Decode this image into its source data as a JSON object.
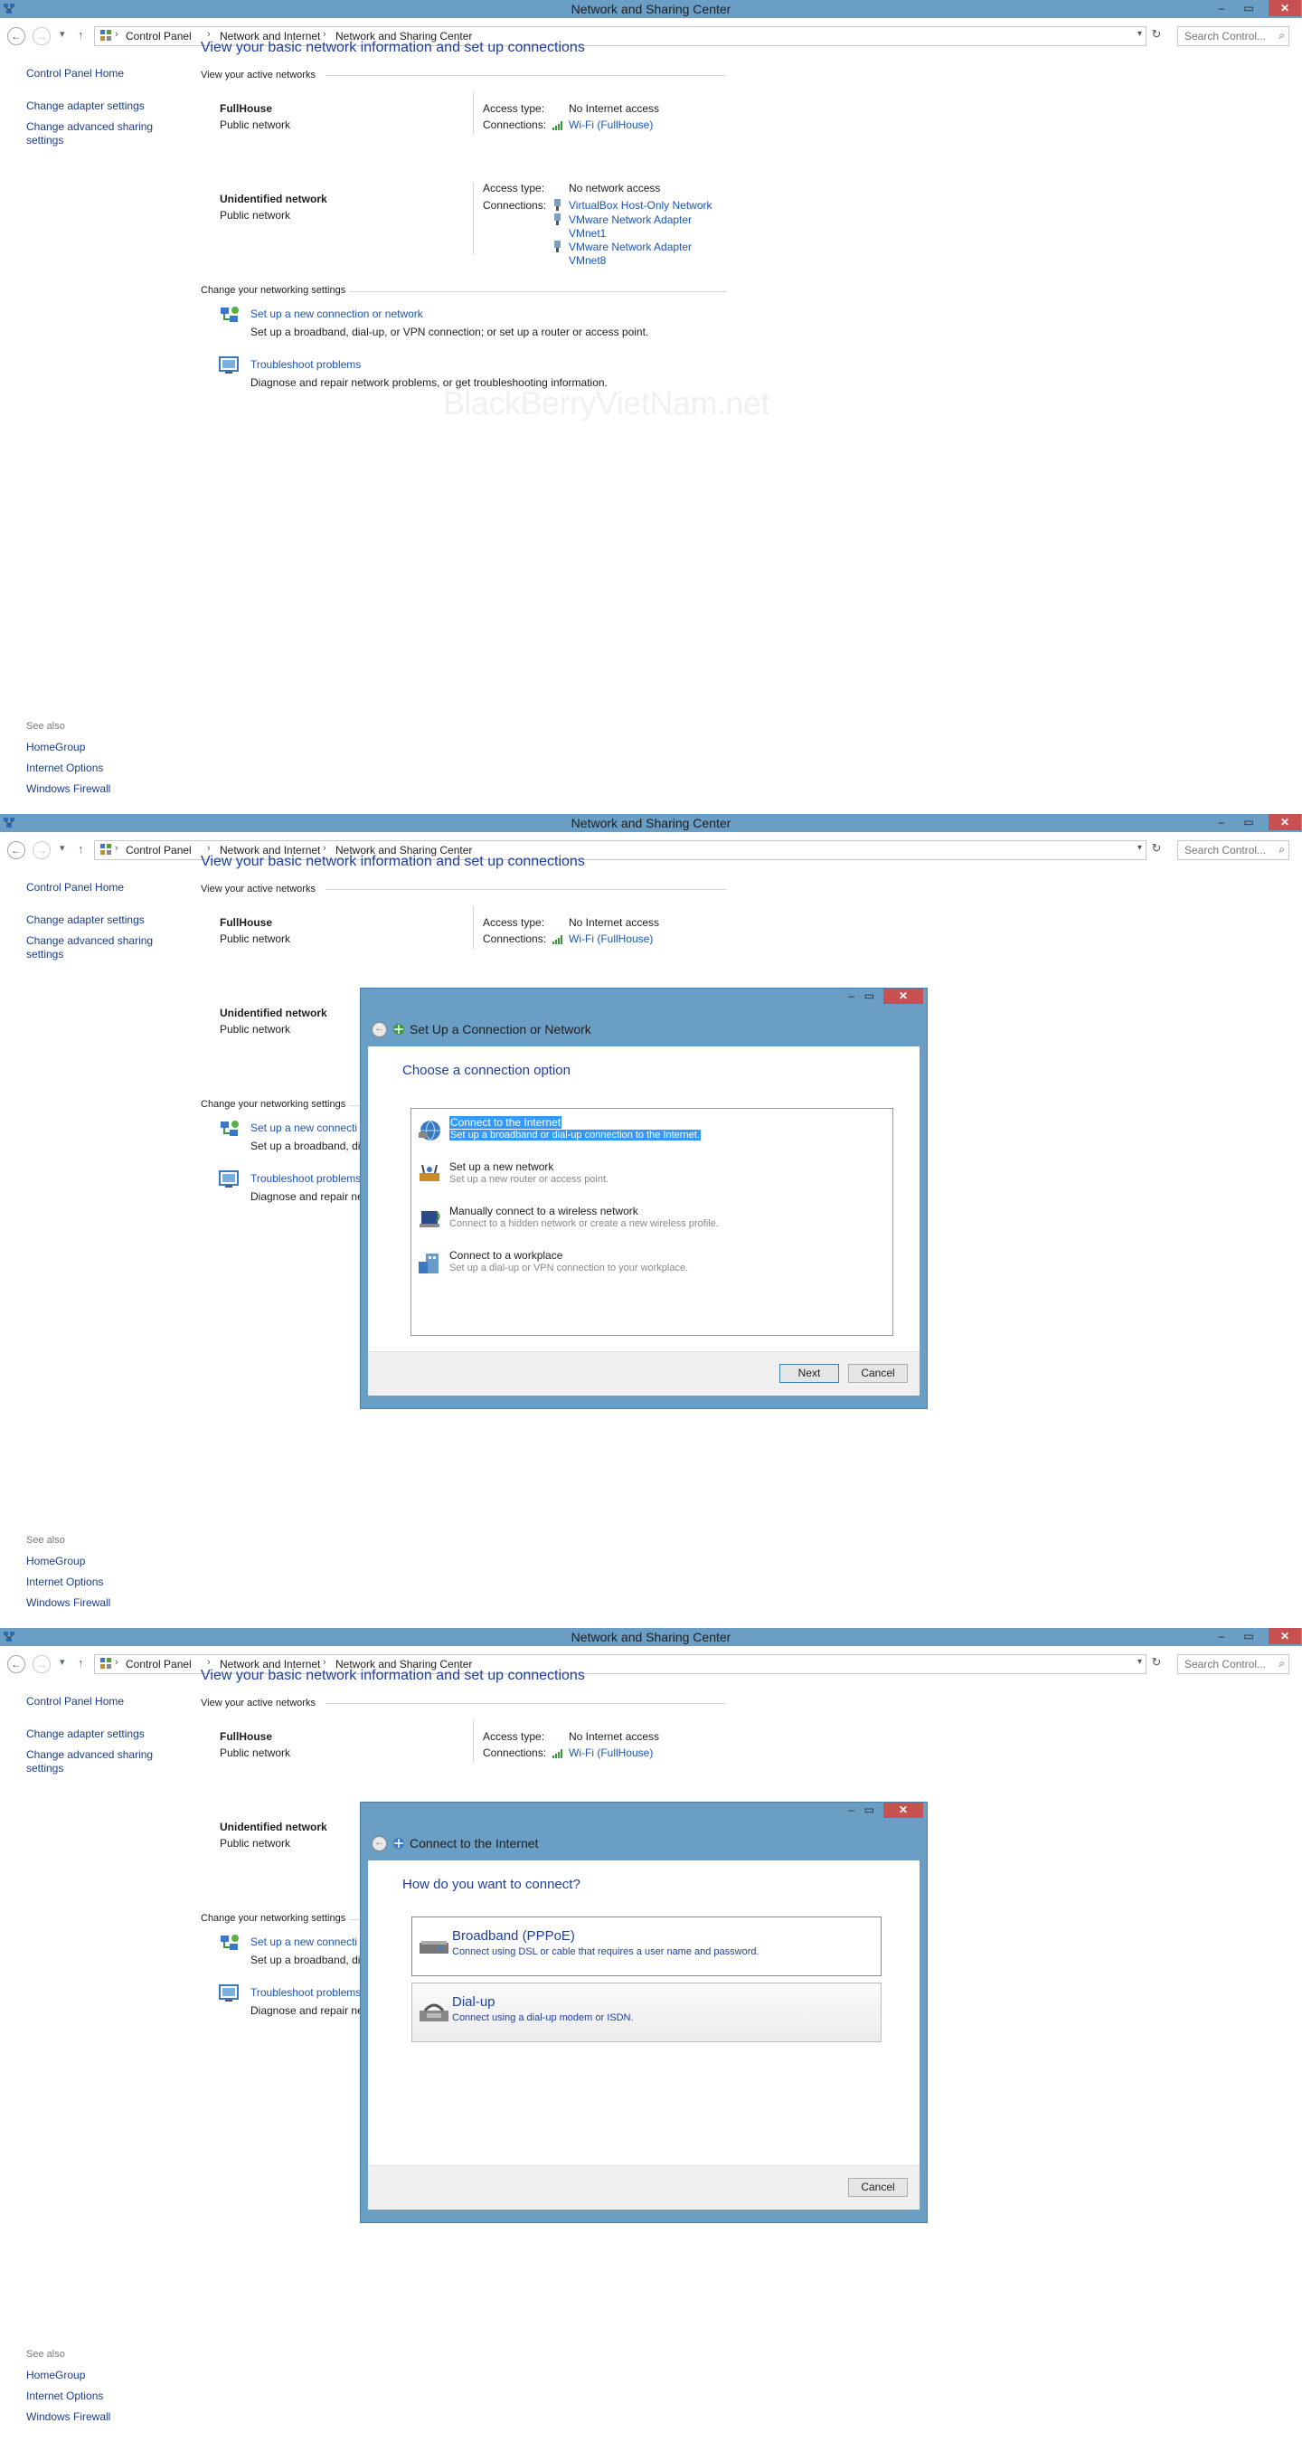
{
  "window": {
    "title": "Network and Sharing Center",
    "controls": {
      "minimize": "–",
      "maximize": "▭",
      "close": "✕"
    }
  },
  "address": {
    "crumbs": [
      "Control Panel",
      "Network and Internet",
      "Network and Sharing Center"
    ],
    "search_placeholder": "Search Control..."
  },
  "sidebar": {
    "home": "Control Panel Home",
    "items": [
      "Change adapter settings",
      "Change advanced sharing",
      "settings"
    ],
    "see_also_title": "See also",
    "see_also": [
      "HomeGroup",
      "Internet Options",
      "Windows Firewall"
    ]
  },
  "main": {
    "heading": "View your basic network information and set up connections",
    "active_networks_label": "View your active networks",
    "networks": [
      {
        "name": "FullHouse",
        "type": "Public network",
        "access_label": "Access type:",
        "access_value": "No Internet access",
        "connections_label": "Connections:",
        "connections": [
          "Wi-Fi (FullHouse)"
        ]
      },
      {
        "name": "Unidentified network",
        "type": "Public network",
        "access_label": "Access type:",
        "access_value": "No network access",
        "connections_label": "Connections:",
        "connections": [
          "VirtualBox Host-Only Network",
          "VMware Network Adapter",
          "VMnet1",
          "VMware Network Adapter",
          "VMnet8"
        ]
      }
    ],
    "change_settings_label": "Change your networking settings",
    "tasks": [
      {
        "title": "Set up a new connection or network",
        "desc": "Set up a broadband, dial-up, or VPN connection; or set up a router or access point."
      },
      {
        "title": "Troubleshoot problems",
        "desc": "Diagnose and repair network problems, or get troubleshooting information."
      }
    ],
    "truncated_tasks": [
      {
        "title": "Set up a new connecti",
        "desc": "Set up a broadband, dia"
      },
      {
        "title": "Troubleshoot problems",
        "desc": "Diagnose and repair ne"
      }
    ]
  },
  "watermark": "BlackBerryVietNam.net",
  "dialog1": {
    "title": "Set Up a Connection or Network",
    "question": "Choose a connection option",
    "options": [
      {
        "title": "Connect to the Internet",
        "desc": "Set up a broadband or dial-up connection to the Internet.",
        "selected": true
      },
      {
        "title": "Set up a new network",
        "desc": "Set up a new router or access point.",
        "selected": false
      },
      {
        "title": "Manually connect to a wireless network",
        "desc": "Connect to a hidden network or create a new wireless profile.",
        "selected": false
      },
      {
        "title": "Connect to a workplace",
        "desc": "Set up a dial-up or VPN connection to your workplace.",
        "selected": false
      }
    ],
    "next": "Next",
    "cancel": "Cancel"
  },
  "dialog2": {
    "title": "Connect to the Internet",
    "question": "How do you want to connect?",
    "options": [
      {
        "title": "Broadband (PPPoE)",
        "desc": "Connect using DSL or cable that requires a user name and password."
      },
      {
        "title": "Dial-up",
        "desc": "Connect using a dial-up modem or ISDN."
      }
    ],
    "cancel": "Cancel"
  },
  "colors": {
    "titlebar": "#6b9ec4",
    "link": "#1a55b8",
    "heading": "#1e3f9e",
    "close": "#c75050",
    "selection": "#3399ff"
  }
}
